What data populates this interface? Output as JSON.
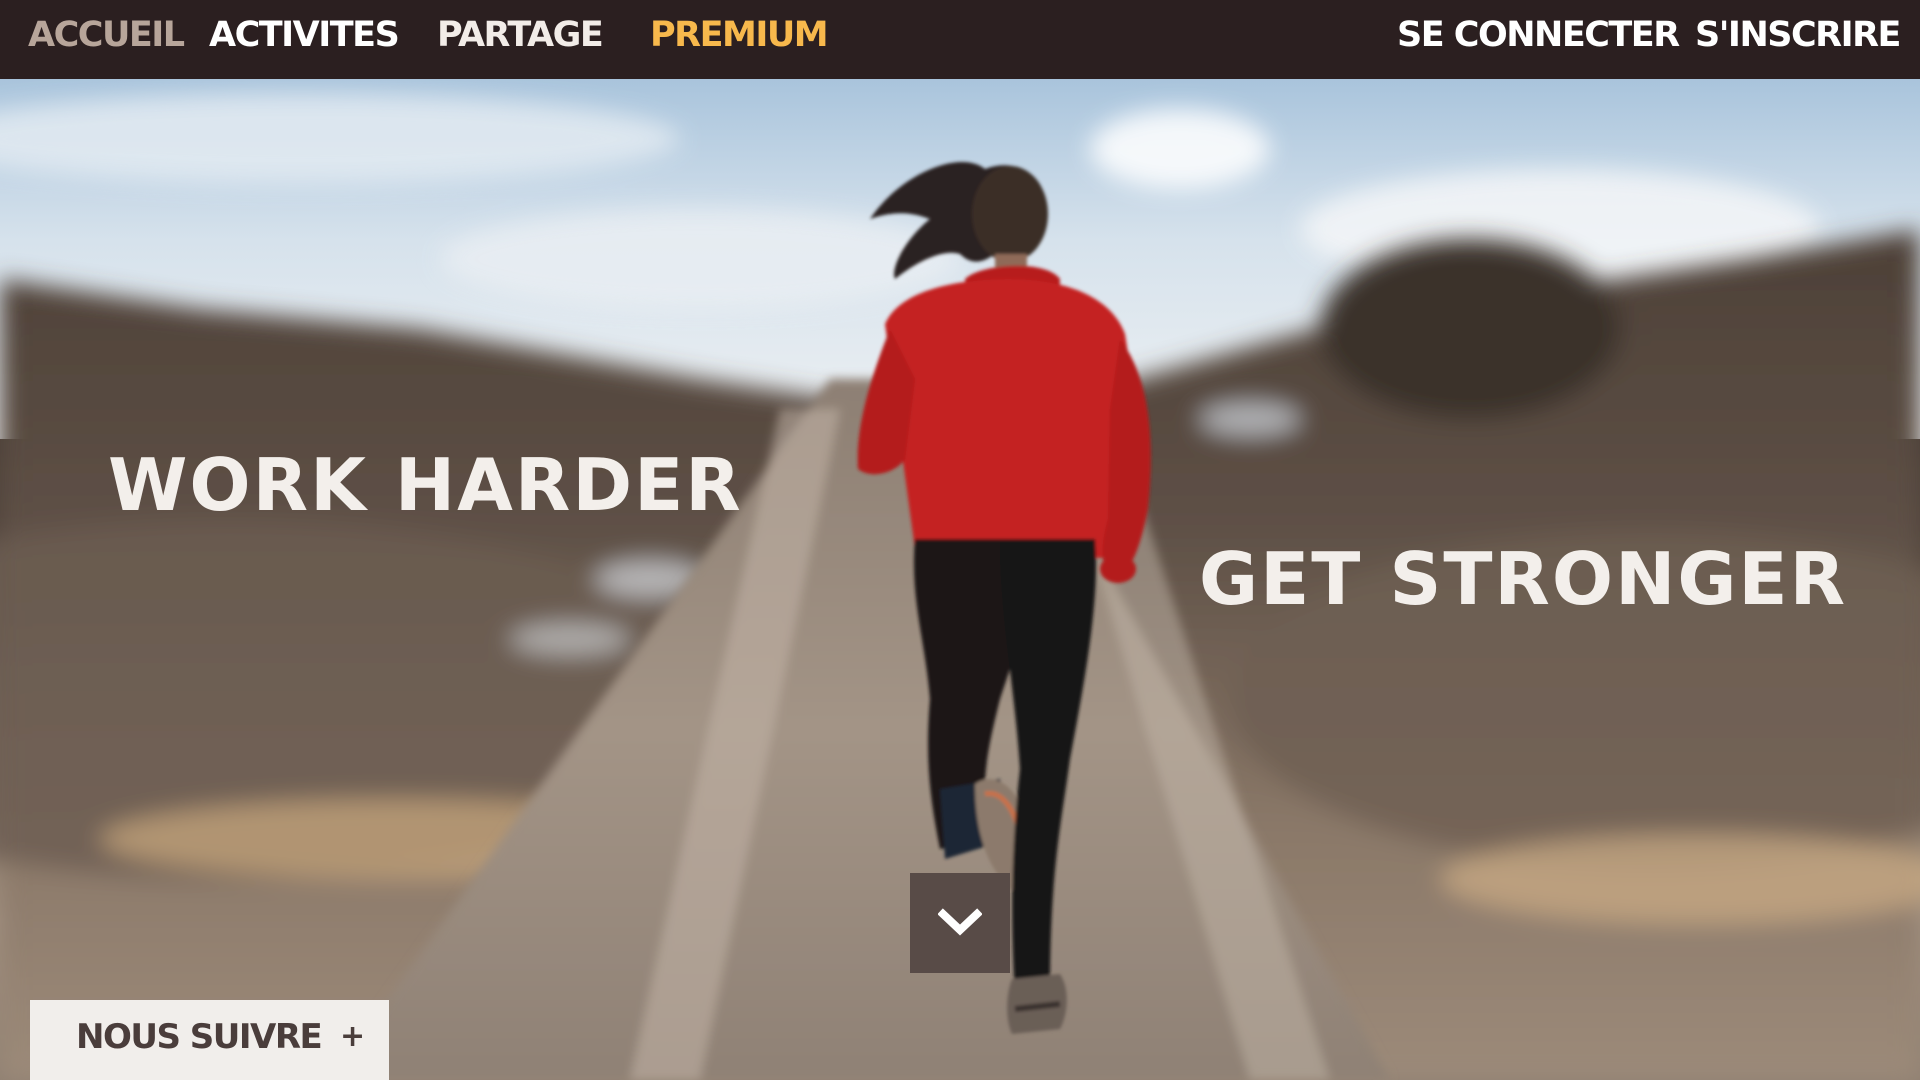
{
  "nav": {
    "left_items": [
      {
        "label": "ACCUEIL",
        "state": "active",
        "color": "#b7a59a"
      },
      {
        "label": "ACTIVITES",
        "color": "#ffffff"
      },
      {
        "label": "PARTAGE",
        "color": "#f2ece8"
      },
      {
        "label": "PREMIUM",
        "color": "#f7b84c"
      }
    ],
    "right_items": [
      {
        "label": "SE CONNECTER"
      },
      {
        "label": "S'INSCRIRE"
      }
    ],
    "background": "#2b1f20"
  },
  "hero": {
    "headline_left": "WORK HARDER",
    "headline_right": "GET STRONGER",
    "scroll_icon": "chevron-down-icon",
    "background_image": "woman-running-on-road-photo"
  },
  "follow": {
    "label": "NOUS SUIVRE",
    "icon": "+"
  },
  "colors": {
    "accent": "#f7b84c",
    "dark": "#2b1f20",
    "button": "#584b47",
    "light": "#f1eeeb"
  }
}
